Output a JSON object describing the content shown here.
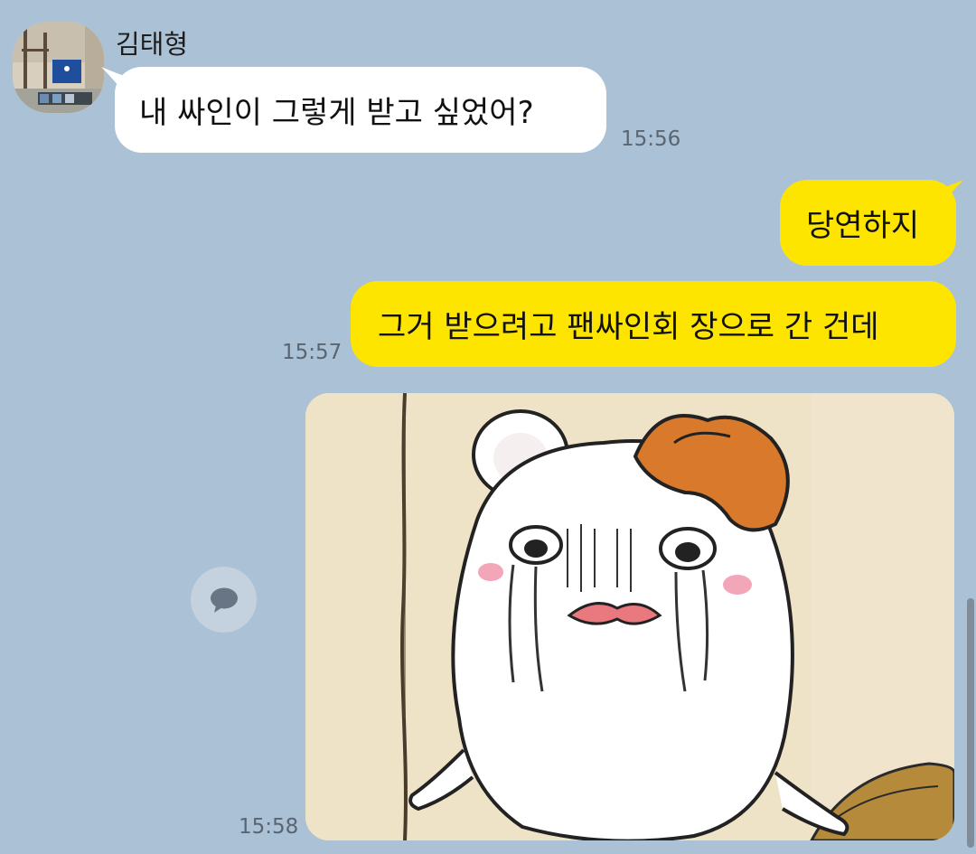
{
  "chat": {
    "sender_name": "김태형",
    "messages": [
      {
        "direction": "incoming",
        "text": "내 싸인이 그렇게 받고 싶었어?",
        "time": "15:56"
      },
      {
        "direction": "outgoing",
        "text": "당연하지",
        "time": ""
      },
      {
        "direction": "outgoing",
        "text": "그거 받으려고 팬싸인회 장으로 간 건데",
        "time": "15:57"
      },
      {
        "direction": "outgoing",
        "type": "image",
        "time": "15:58"
      }
    ]
  },
  "colors": {
    "background": "#abc1d6",
    "incoming_bubble": "#ffffff",
    "outgoing_bubble": "#fee500",
    "timestamp": "#5a6572"
  },
  "icons": {
    "share": "speech-bubble-icon"
  }
}
